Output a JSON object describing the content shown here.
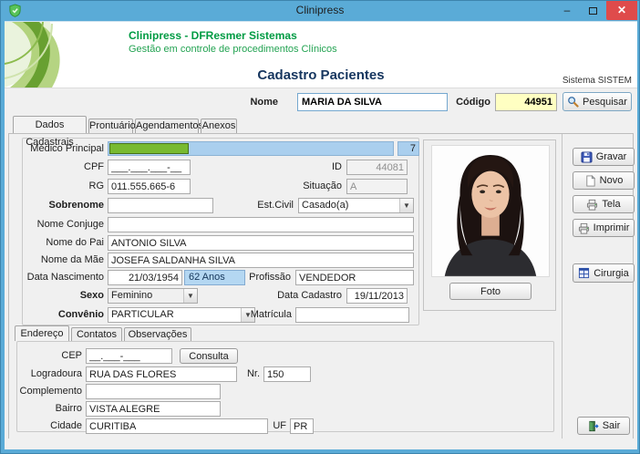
{
  "window": {
    "title": "Clinipress",
    "minimize_glyph": "–",
    "close_glyph": "✕"
  },
  "header": {
    "brand": "Clinipress - DFResmer Sistemas",
    "tagline": "Gestão em controle de procedimentos Clínicos",
    "page_title": "Cadastro Pacientes",
    "system": "Sistema SISTEM"
  },
  "search": {
    "nome_label": "Nome",
    "nome_value": "MARIA DA SILVA",
    "codigo_label": "Código",
    "codigo_value": "44951",
    "pesquisar": "Pesquisar"
  },
  "tabs": {
    "main": [
      "Dados Cadastrais",
      "Prontuário",
      "Agendamentos",
      "Anexos"
    ],
    "address": [
      "Endereço",
      "Contatos",
      "Observações"
    ]
  },
  "form": {
    "medico_principal": {
      "label": "Médico Principal",
      "value": "7",
      "progress_pct": 28
    },
    "cpf": {
      "label": "CPF",
      "value": "___.___.___-__"
    },
    "id": {
      "label": "ID",
      "value": "44081"
    },
    "rg": {
      "label": "RG",
      "value": "011.555.665-6"
    },
    "situacao": {
      "label": "Situação",
      "value": "A"
    },
    "sobrenome": {
      "label": "Sobrenome",
      "value": ""
    },
    "est_civil": {
      "label": "Est.Civil",
      "value": "Casado(a)"
    },
    "nome_conjuge": {
      "label": "Nome Conjuge",
      "value": ""
    },
    "nome_pai": {
      "label": "Nome do Pai",
      "value": "ANTONIO SILVA"
    },
    "nome_mae": {
      "label": "Nome da Mãe",
      "value": "JOSEFA SALDANHA SILVA"
    },
    "data_nascimento": {
      "label": "Data Nascimento",
      "value": "21/03/1954",
      "idade": "62 Anos"
    },
    "profissao": {
      "label": "Profissão",
      "value": "VENDEDOR"
    },
    "sexo": {
      "label": "Sexo",
      "value": "Feminino"
    },
    "data_cadastro": {
      "label": "Data Cadastro",
      "value": "19/11/2013"
    },
    "convenio": {
      "label": "Convênio",
      "value": "PARTICULAR"
    },
    "matricula": {
      "label": "Matrícula",
      "value": ""
    }
  },
  "photo": {
    "button": "Foto"
  },
  "actions": {
    "gravar": "Gravar",
    "novo": "Novo",
    "tela": "Tela",
    "imprimir": "Imprimir",
    "cirurgia": "Cirurgia",
    "sair": "Sair"
  },
  "address": {
    "cep": {
      "label": "CEP",
      "value": "__.___-___",
      "consulta": "Consulta"
    },
    "logradoura": {
      "label": "Logradoura",
      "value": "RUA DAS FLORES"
    },
    "nr": {
      "label": "Nr.",
      "value": "150"
    },
    "complemento": {
      "label": "Complemento",
      "value": ""
    },
    "bairro": {
      "label": "Bairro",
      "value": "VISTA ALEGRE"
    },
    "cidade": {
      "label": "Cidade",
      "value": "CURITIBA"
    },
    "uf": {
      "label": "UF",
      "value": "PR"
    }
  },
  "icons": {
    "app": "green-shield",
    "pesquisar": "magnifier",
    "gravar": "floppy-disk",
    "novo": "new-document",
    "tela": "printer",
    "imprimir": "printer",
    "cirurgia": "window-grid",
    "sair": "exit-door"
  },
  "colors": {
    "titlebar_blue": "#5aabd7",
    "close_red": "#df4b4b",
    "brand_green": "#009b43",
    "title_navy": "#16365f",
    "progress_green": "#78ba30",
    "progress_track_blue": "#aacfee",
    "age_highlight_blue": "#b4d7f2",
    "codigo_yellow": "#ffffc2"
  }
}
